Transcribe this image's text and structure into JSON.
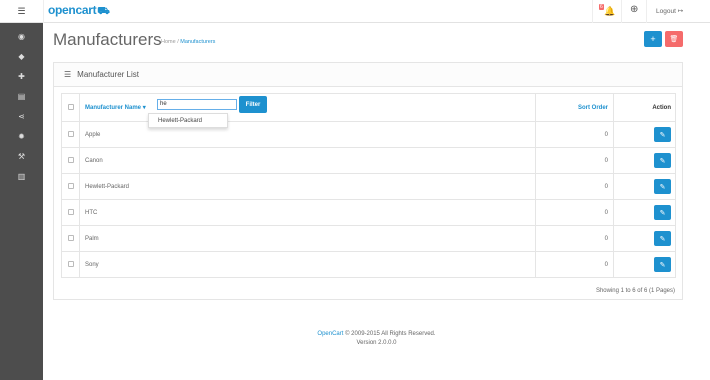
{
  "header": {
    "logo_text": "opencart",
    "logo_cart": "⛟",
    "notification_count": "6",
    "logout_label": "Logout"
  },
  "sidebar": {
    "items": [
      {
        "icon": "dashboard-icon",
        "glyph": "◉"
      },
      {
        "icon": "tags-icon",
        "glyph": "◆"
      },
      {
        "icon": "puzzle-icon",
        "glyph": "✚"
      },
      {
        "icon": "cart-icon",
        "glyph": "▤"
      },
      {
        "icon": "share-icon",
        "glyph": "⋖"
      },
      {
        "icon": "gear-icon",
        "glyph": "✹"
      },
      {
        "icon": "wrench-icon",
        "glyph": "⚒"
      },
      {
        "icon": "chart-icon",
        "glyph": "▥"
      }
    ]
  },
  "page": {
    "title": "Manufacturers",
    "breadcrumb_home": "Home",
    "breadcrumb_sep": "/",
    "breadcrumb_current": "Manufacturers"
  },
  "panel": {
    "title": "Manufacturer List"
  },
  "table": {
    "col_name": "Manufacturer Name",
    "col_sort": "Sort Order",
    "col_action": "Action",
    "rows": [
      {
        "name": "Apple",
        "sort": "0"
      },
      {
        "name": "Canon",
        "sort": "0"
      },
      {
        "name": "Hewlett-Packard",
        "sort": "0"
      },
      {
        "name": "HTC",
        "sort": "0"
      },
      {
        "name": "Palm",
        "sort": "0"
      },
      {
        "name": "Sony",
        "sort": "0"
      }
    ]
  },
  "filter": {
    "value": "he",
    "button_label": "Filter",
    "suggestion": "Hewlett-Packard"
  },
  "pagination": {
    "results_text": "Showing 1 to 6 of 6 (1 Pages)"
  },
  "footer": {
    "link_text": "OpenCart",
    "copyright": "© 2009-2015 All Rights Reserved.",
    "version": "Version 2.0.0.0"
  },
  "colors": {
    "primary": "#1e91cf",
    "danger": "#f56b6b",
    "sidebar": "#4d4d4d"
  }
}
